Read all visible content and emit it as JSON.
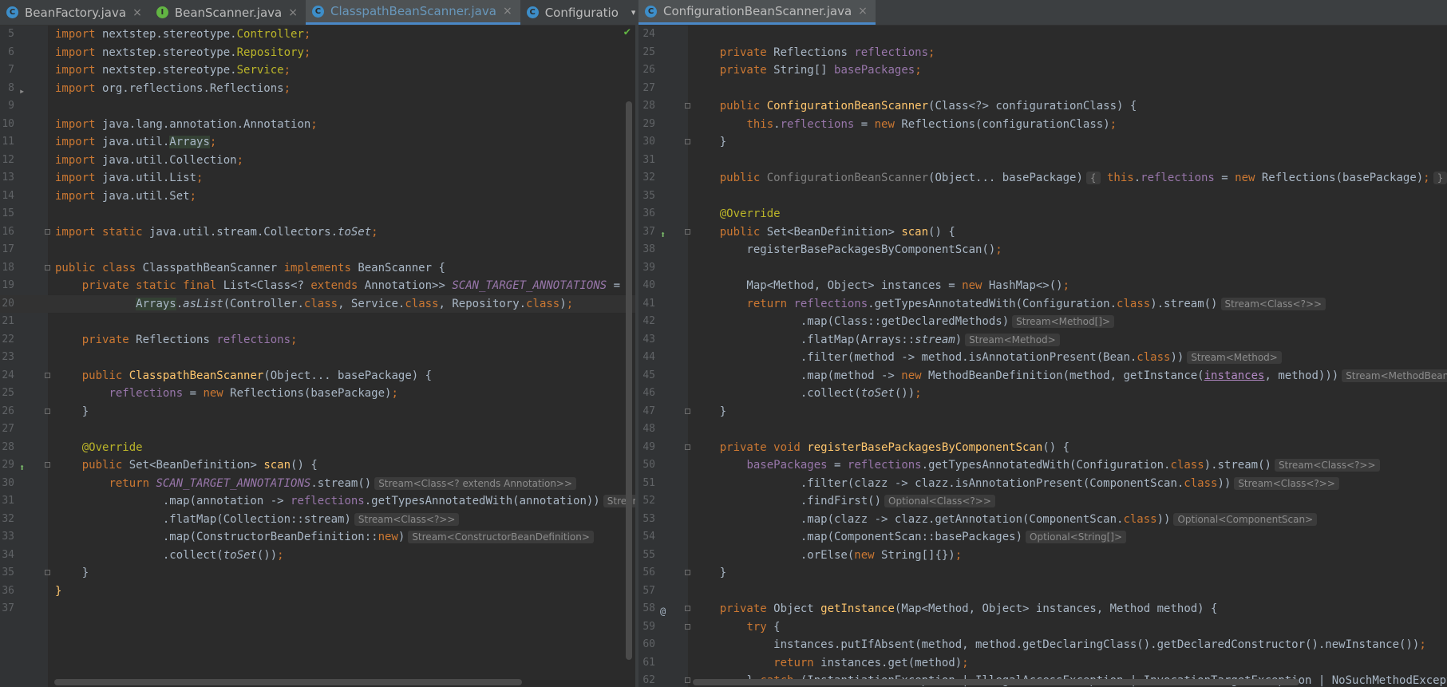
{
  "left_tabs": [
    {
      "label": "BeanFactory.java",
      "icon": "class-icon"
    },
    {
      "label": "BeanScanner.java",
      "icon": "interface-icon"
    },
    {
      "label": "ClasspathBeanScanner.java",
      "icon": "class-icon",
      "active": true
    },
    {
      "label": "Configuratio",
      "icon": "class-icon"
    }
  ],
  "left_tab_menu": "1",
  "right_tabs": [
    {
      "label": "ConfigurationBeanScanner.java",
      "icon": "class-icon",
      "active": true
    }
  ],
  "icon_letters": {
    "class": "C",
    "interface": "I"
  },
  "colors": {
    "keyword": "#cc7832",
    "annotation": "#bbb529",
    "field": "#9876aa",
    "method": "#ffc66d",
    "accent": "#4a88c7"
  },
  "left_editor": {
    "lines": [
      {
        "n": "5",
        "html": "<span class=\"kw\">import</span> nextstep.stereotype.<span class=\"an\">Controller</span><span class=\"kw\">;</span>"
      },
      {
        "n": "6",
        "html": "<span class=\"kw\">import</span> nextstep.stereotype.<span class=\"an\">Repository</span><span class=\"kw\">;</span>"
      },
      {
        "n": "7",
        "html": "<span class=\"kw\">import</span> nextstep.stereotype.<span class=\"an\">Service</span><span class=\"kw\">;</span>"
      },
      {
        "n": "8",
        "html": "<span class=\"kw\">import</span> org.reflections.Reflections<span class=\"kw\">;</span>"
      },
      {
        "n": "9",
        "html": ""
      },
      {
        "n": "10",
        "html": "<span class=\"kw\">import</span> java.lang.annotation.Annotation<span class=\"kw\">;</span>"
      },
      {
        "n": "11",
        "html": "<span class=\"kw\">import</span> java.util.<span class=\"hl\">Arrays</span><span class=\"kw\">;</span>"
      },
      {
        "n": "12",
        "html": "<span class=\"kw\">import</span> java.util.Collection<span class=\"kw\">;</span>"
      },
      {
        "n": "13",
        "html": "<span class=\"kw\">import</span> java.util.List<span class=\"kw\">;</span>"
      },
      {
        "n": "14",
        "html": "<span class=\"kw\">import</span> java.util.Set<span class=\"kw\">;</span>"
      },
      {
        "n": "15",
        "html": ""
      },
      {
        "n": "16",
        "html": "<span class=\"kw\">import static</span> java.util.stream.Collectors.<span class=\"itl\">toSet</span><span class=\"kw\">;</span>"
      },
      {
        "n": "17",
        "html": ""
      },
      {
        "n": "18",
        "html": "<span class=\"kw\">public class</span> ClasspathBeanScanner <span class=\"kw\">implements</span> BeanScanner {"
      },
      {
        "n": "19",
        "html": "    <span class=\"kw\">private static final</span> List&lt;Class&lt;? <span class=\"kw\">extends</span> Annotation&gt;&gt; <span class=\"st\">SCAN_TARGET_ANNOTATIONS</span> ="
      },
      {
        "n": "20",
        "html": "            <span class=\"hl\">Arrays</span>.<span class=\"itl\">asList</span>(Controller.<span class=\"kw\">class</span>, Service.<span class=\"kw\">class</span>, Repository.<span class=\"kw\">class</span>)<span class=\"kw\">;</span>",
        "current": true
      },
      {
        "n": "21",
        "html": ""
      },
      {
        "n": "22",
        "html": "    <span class=\"kw\">private</span> Reflections <span class=\"fld\">reflections</span><span class=\"kw\">;</span>"
      },
      {
        "n": "23",
        "html": ""
      },
      {
        "n": "24",
        "html": "    <span class=\"kw\">public</span> <span class=\"mth\">ClasspathBeanScanner</span>(Object... basePackage) {"
      },
      {
        "n": "25",
        "html": "        <span class=\"fld\">reflections</span> = <span class=\"kw\">new</span> Reflections(basePackage)<span class=\"kw\">;</span>"
      },
      {
        "n": "26",
        "html": "    }"
      },
      {
        "n": "27",
        "html": ""
      },
      {
        "n": "28",
        "html": "    <span class=\"an\">@Override</span>"
      },
      {
        "n": "29",
        "html": "    <span class=\"kw\">public</span> Set&lt;BeanDefinition&gt; <span class=\"mth\">scan</span>() {"
      },
      {
        "n": "30",
        "html": "        <span class=\"kw\">return</span> <span class=\"st\">SCAN_TARGET_ANNOTATIONS</span>.stream()<span class=\"hint\">Stream&lt;Class&lt;? extends Annotation&gt;&gt;</span>"
      },
      {
        "n": "31",
        "html": "                .map(annotation -&gt; <span class=\"fld\">reflections</span>.getTypesAnnotatedWith(annotation))<span class=\"hint\">Stream&lt;Se</span>"
      },
      {
        "n": "32",
        "html": "                .flatMap(Collection::stream)<span class=\"hint\">Stream&lt;Class&lt;?&gt;&gt;</span>"
      },
      {
        "n": "33",
        "html": "                .map(ConstructorBeanDefinition::<span class=\"kw\">new</span>)<span class=\"hint\">Stream&lt;ConstructorBeanDefinition&gt;</span>"
      },
      {
        "n": "34",
        "html": "                .collect(<span class=\"itl\">toSet</span>())<span class=\"kw\">;</span>"
      },
      {
        "n": "35",
        "html": "    }"
      },
      {
        "n": "36",
        "html": "<span class=\"mth\">}</span>"
      },
      {
        "n": "37",
        "html": ""
      }
    ]
  },
  "right_editor": {
    "lines": [
      {
        "n": "24",
        "html": ""
      },
      {
        "n": "25",
        "html": "    <span class=\"kw\">private</span> Reflections <span class=\"fld\">reflections</span><span class=\"kw\">;</span>"
      },
      {
        "n": "26",
        "html": "    <span class=\"kw\">private</span> String[] <span class=\"fld\">basePackages</span><span class=\"kw\">;</span>"
      },
      {
        "n": "27",
        "html": ""
      },
      {
        "n": "28",
        "html": "    <span class=\"kw\">public</span> <span class=\"mth\">ConfigurationBeanScanner</span>(Class&lt;?&gt; configurationClass) {"
      },
      {
        "n": "29",
        "html": "        <span class=\"kw\">this</span>.<span class=\"fld\">reflections</span> = <span class=\"kw\">new</span> Reflections(configurationClass)<span class=\"kw\">;</span>"
      },
      {
        "n": "30",
        "html": "    }"
      },
      {
        "n": "31",
        "html": ""
      },
      {
        "n": "32",
        "html": "    <span class=\"kw\">public</span> <span class=\"gry\">ConfigurationBeanScanner</span>(Object... basePackage)<span class=\"hint\">{</span> <span class=\"kw\">this</span>.<span class=\"fld\">reflections</span> = <span class=\"kw\">new</span> Reflections(basePackage)<span class=\"kw\">;</span><span class=\"hint\">}</span>"
      },
      {
        "n": "35",
        "html": ""
      },
      {
        "n": "36",
        "html": "    <span class=\"an\">@Override</span>"
      },
      {
        "n": "37",
        "html": "    <span class=\"kw\">public</span> Set&lt;BeanDefinition&gt; <span class=\"mth\">scan</span>() {"
      },
      {
        "n": "38",
        "html": "        registerBasePackagesByComponentScan()<span class=\"kw\">;</span>"
      },
      {
        "n": "39",
        "html": ""
      },
      {
        "n": "40",
        "html": "        Map&lt;Method, Object&gt; instances = <span class=\"kw\">new</span> HashMap&lt;&gt;()<span class=\"kw\">;</span>"
      },
      {
        "n": "41",
        "html": "        <span class=\"kw\">return</span> <span class=\"fld\">reflections</span>.getTypesAnnotatedWith(Configuration.<span class=\"kw\">class</span>).stream()<span class=\"hint\">Stream&lt;Class&lt;?&gt;&gt;</span>"
      },
      {
        "n": "42",
        "html": "                .map(Class::getDeclaredMethods)<span class=\"hint\">Stream&lt;Method[]&gt;</span>"
      },
      {
        "n": "43",
        "html": "                .flatMap(Arrays::<span class=\"itl\">stream</span>)<span class=\"hint\">Stream&lt;Method&gt;</span>"
      },
      {
        "n": "44",
        "html": "                .filter(method -&gt; method.isAnnotationPresent(Bean.<span class=\"kw\">class</span>))<span class=\"hint\">Stream&lt;Method&gt;</span>"
      },
      {
        "n": "45",
        "html": "                .map(method -&gt; <span class=\"kw\">new</span> MethodBeanDefinition(method, getInstance(<span class=\"u\">instances</span>, method)))<span class=\"hint\">Stream&lt;MethodBeanDefi</span>"
      },
      {
        "n": "46",
        "html": "                .collect(<span class=\"itl\">toSet</span>())<span class=\"kw\">;</span>"
      },
      {
        "n": "47",
        "html": "    }"
      },
      {
        "n": "48",
        "html": ""
      },
      {
        "n": "49",
        "html": "    <span class=\"kw\">private void</span> <span class=\"mth\">registerBasePackagesByComponentScan</span>() {"
      },
      {
        "n": "50",
        "html": "        <span class=\"fld\">basePackages</span> = <span class=\"fld\">reflections</span>.getTypesAnnotatedWith(Configuration.<span class=\"kw\">class</span>).stream()<span class=\"hint\">Stream&lt;Class&lt;?&gt;&gt;</span>"
      },
      {
        "n": "51",
        "html": "                .filter(clazz -&gt; clazz.isAnnotationPresent(ComponentScan.<span class=\"kw\">class</span>))<span class=\"hint\">Stream&lt;Class&lt;?&gt;&gt;</span>"
      },
      {
        "n": "52",
        "html": "                .findFirst()<span class=\"hint\">Optional&lt;Class&lt;?&gt;&gt;</span>"
      },
      {
        "n": "53",
        "html": "                .map(clazz -&gt; clazz.getAnnotation(ComponentScan.<span class=\"kw\">class</span>))<span class=\"hint\">Optional&lt;ComponentScan&gt;</span>"
      },
      {
        "n": "54",
        "html": "                .map(ComponentScan::basePackages)<span class=\"hint\">Optional&lt;String[]&gt;</span>"
      },
      {
        "n": "55",
        "html": "                .orElse(<span class=\"kw\">new</span> String[]{})<span class=\"kw\">;</span>"
      },
      {
        "n": "56",
        "html": "    }"
      },
      {
        "n": "57",
        "html": ""
      },
      {
        "n": "58",
        "html": "    <span class=\"kw\">private</span> Object <span class=\"mth\">getInstance</span>(Map&lt;Method, Object&gt; instances, Method method) {"
      },
      {
        "n": "59",
        "html": "        <span class=\"kw\">try</span> {"
      },
      {
        "n": "60",
        "html": "            instances.putIfAbsent(method, method.getDeclaringClass().getDeclaredConstructor().newInstance())<span class=\"kw\">;</span>"
      },
      {
        "n": "61",
        "html": "            <span class=\"kw\">return</span> instances.get(method)<span class=\"kw\">;</span>"
      },
      {
        "n": "62",
        "html": "        } <span class=\"kw\">catch</span> (InstantiationException | IllegalAccessException | InvocationTargetException | NoSuchMethodException e"
      }
    ]
  },
  "gutter_marks": {
    "left": {
      "8": "▸",
      "29": "⬆"
    },
    "right": {
      "37": "⬆",
      "58": "@"
    }
  },
  "left_fold_lines": [
    "16",
    "18",
    "24",
    "26",
    "29",
    "35"
  ],
  "right_fold_lines": [
    "28",
    "30",
    "37",
    "47",
    "49",
    "56",
    "58",
    "59",
    "62"
  ],
  "status": {
    "check": "✔"
  }
}
